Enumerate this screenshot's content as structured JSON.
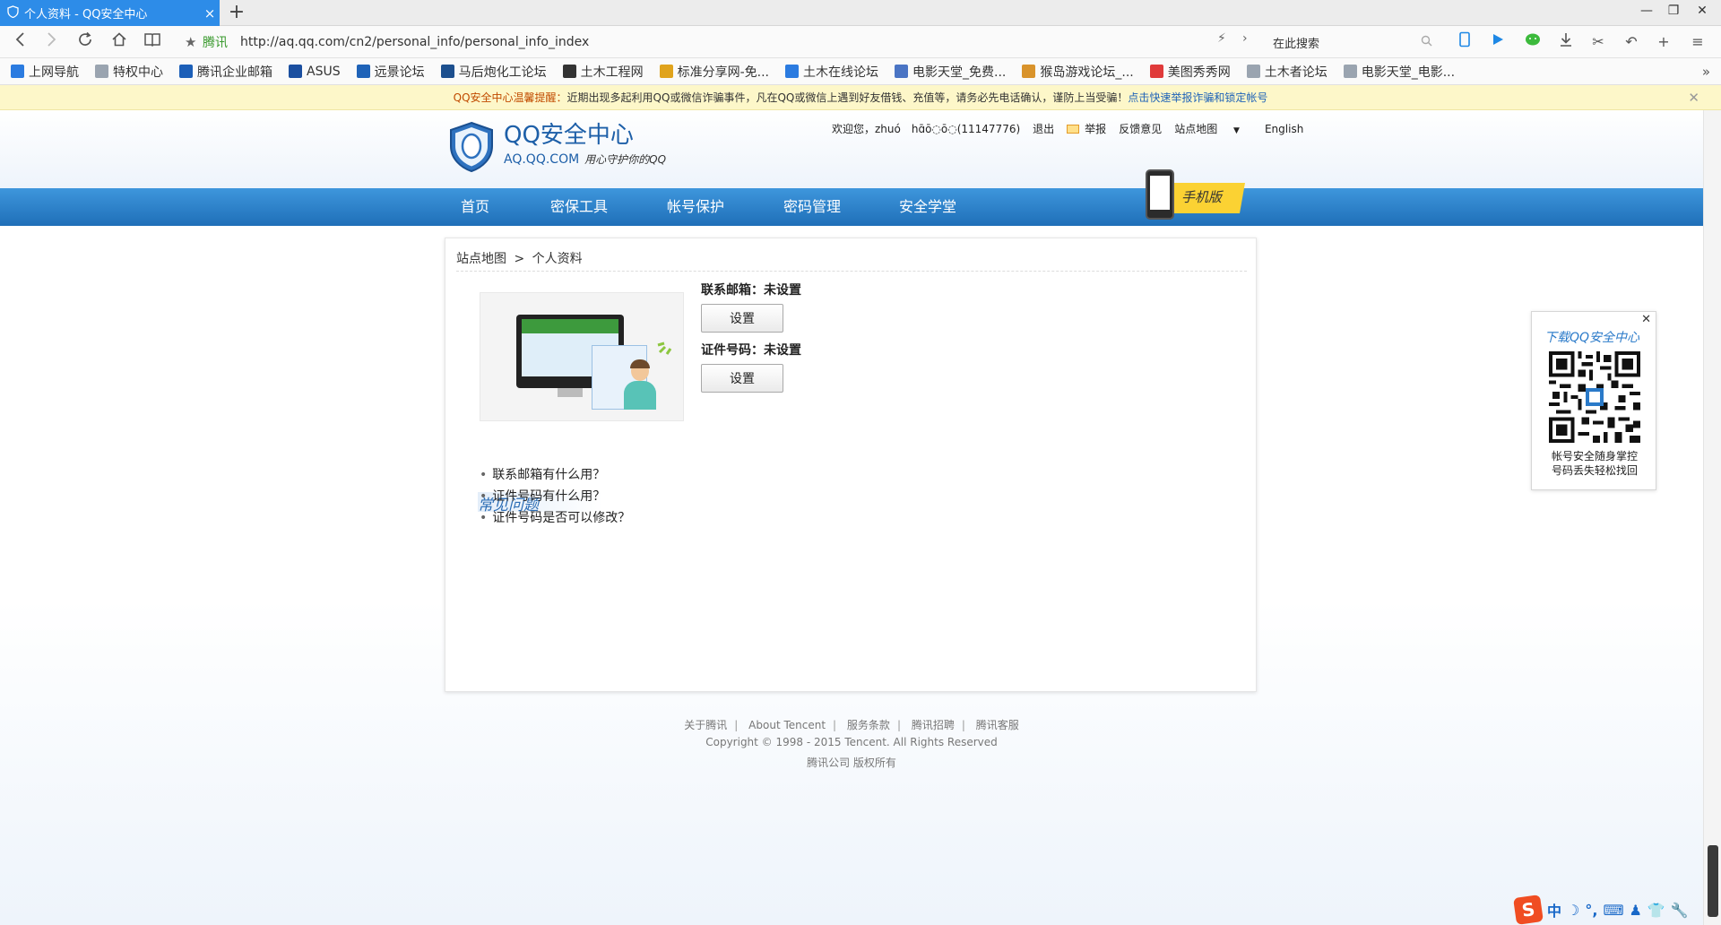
{
  "browser": {
    "tab_title": "个人资料 - QQ安全中心",
    "url_site_label": "腾讯",
    "url": "http://aq.qq.com/cn2/personal_info/personal_info_index",
    "search_placeholder": "在此搜索",
    "bookmarks": [
      {
        "label": "上网导航",
        "icon_color": "#2b7be0"
      },
      {
        "label": "特权中心",
        "icon_color": "#9aa4b0"
      },
      {
        "label": "腾讯企业邮箱",
        "icon_color": "#1c5fb8"
      },
      {
        "label": "ASUS",
        "icon_color": "#1b4fa0"
      },
      {
        "label": "远景论坛",
        "icon_color": "#1f63b8"
      },
      {
        "label": "马后炮化工论坛",
        "icon_color": "#1c4f8e"
      },
      {
        "label": "土木工程网",
        "icon_color": "#333333"
      },
      {
        "label": "标准分享网-免...",
        "icon_color": "#e0a31c"
      },
      {
        "label": "土木在线论坛",
        "icon_color": "#2b7be0"
      },
      {
        "label": "电影天堂_免费...",
        "icon_color": "#4a74c4"
      },
      {
        "label": "猴岛游戏论坛_...",
        "icon_color": "#d9932b"
      },
      {
        "label": "美图秀秀网",
        "icon_color": "#e03a3a"
      },
      {
        "label": "土木者论坛",
        "icon_color": "#9aa4b0"
      },
      {
        "label": "电影天堂_电影...",
        "icon_color": "#9aa4b0"
      }
    ]
  },
  "notice": {
    "prefix": "QQ安全中心温馨提醒：",
    "body": "近期出现多起利用QQ或微信诈骗事件，凡在QQ或微信上遇到好友借钱、充值等，请务必先电话确认，谨防上当受骗！",
    "link": "点击快速举报诈骗和锁定帐号"
  },
  "site": {
    "logo_title": "QQ安全中心",
    "logo_domain": "AQ.QQ.COM",
    "logo_slogan": "用心守护你的QQ",
    "welcome": "欢迎您，zhuó　hɑ̄ō◌ō◌(11147776)",
    "logout": "退出",
    "report": "举报",
    "feedback": "反馈意见",
    "sitemap": "站点地图",
    "english": "English",
    "nav": [
      "首页",
      "密保工具",
      "帐号保护",
      "密码管理",
      "安全学堂"
    ],
    "mobile_label": "手机版"
  },
  "content": {
    "breadcrumb_root": "站点地图",
    "breadcrumb_sep": ">",
    "breadcrumb_current": "个人资料",
    "email_label": "联系邮箱：未设置",
    "id_label": "证件号码：未设置",
    "set_button": "设置",
    "faq_title": "常见问题",
    "faq": [
      "联系邮箱有什么用？",
      "证件号码有什么用？",
      "证件号码是否可以修改？"
    ]
  },
  "footer": {
    "links": [
      "关于腾讯",
      "About Tencent",
      "服务条款",
      "腾讯招聘",
      "腾讯客服"
    ],
    "copyright": "Copyright © 1998 - 2015 Tencent. All Rights Reserved",
    "company": "腾讯公司 版权所有"
  },
  "qr_widget": {
    "title": "下载QQ安全中心",
    "caption_line1": "帐号安全随身掌控",
    "caption_line2": "号码丢失轻松找回"
  },
  "ime": {
    "items": [
      "中",
      "☽",
      "°,",
      "⌨",
      "♟",
      "👕",
      "🔧"
    ]
  },
  "colors": {
    "tab_blue": "#2d8ce8",
    "nav_blue": "#2a7fcc",
    "notice_bg": "#fdf7c9",
    "link_blue": "#1f63b8"
  }
}
